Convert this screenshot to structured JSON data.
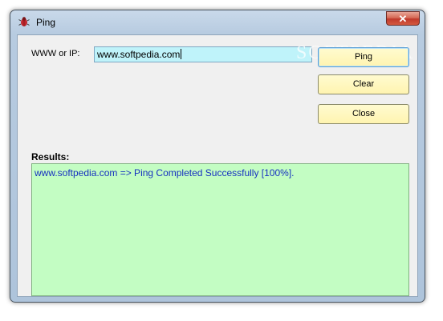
{
  "window": {
    "title": "Ping",
    "close_glyph": "✕"
  },
  "form": {
    "www_label": "WWW or IP:",
    "www_value": "www.softpedia.com",
    "results_label": "Results:"
  },
  "buttons": {
    "ping": "Ping",
    "clear": "Clear",
    "close": "Close"
  },
  "results": {
    "lines": [
      "www.softpedia.com => Ping Completed Successfully [100%]."
    ]
  },
  "watermark": "SOFTPEDIA",
  "colors": {
    "results_bg": "#c3fdc3",
    "results_text": "#1530c0",
    "input_bg": "#bff3fa",
    "button_bg": "#fff4b0"
  }
}
